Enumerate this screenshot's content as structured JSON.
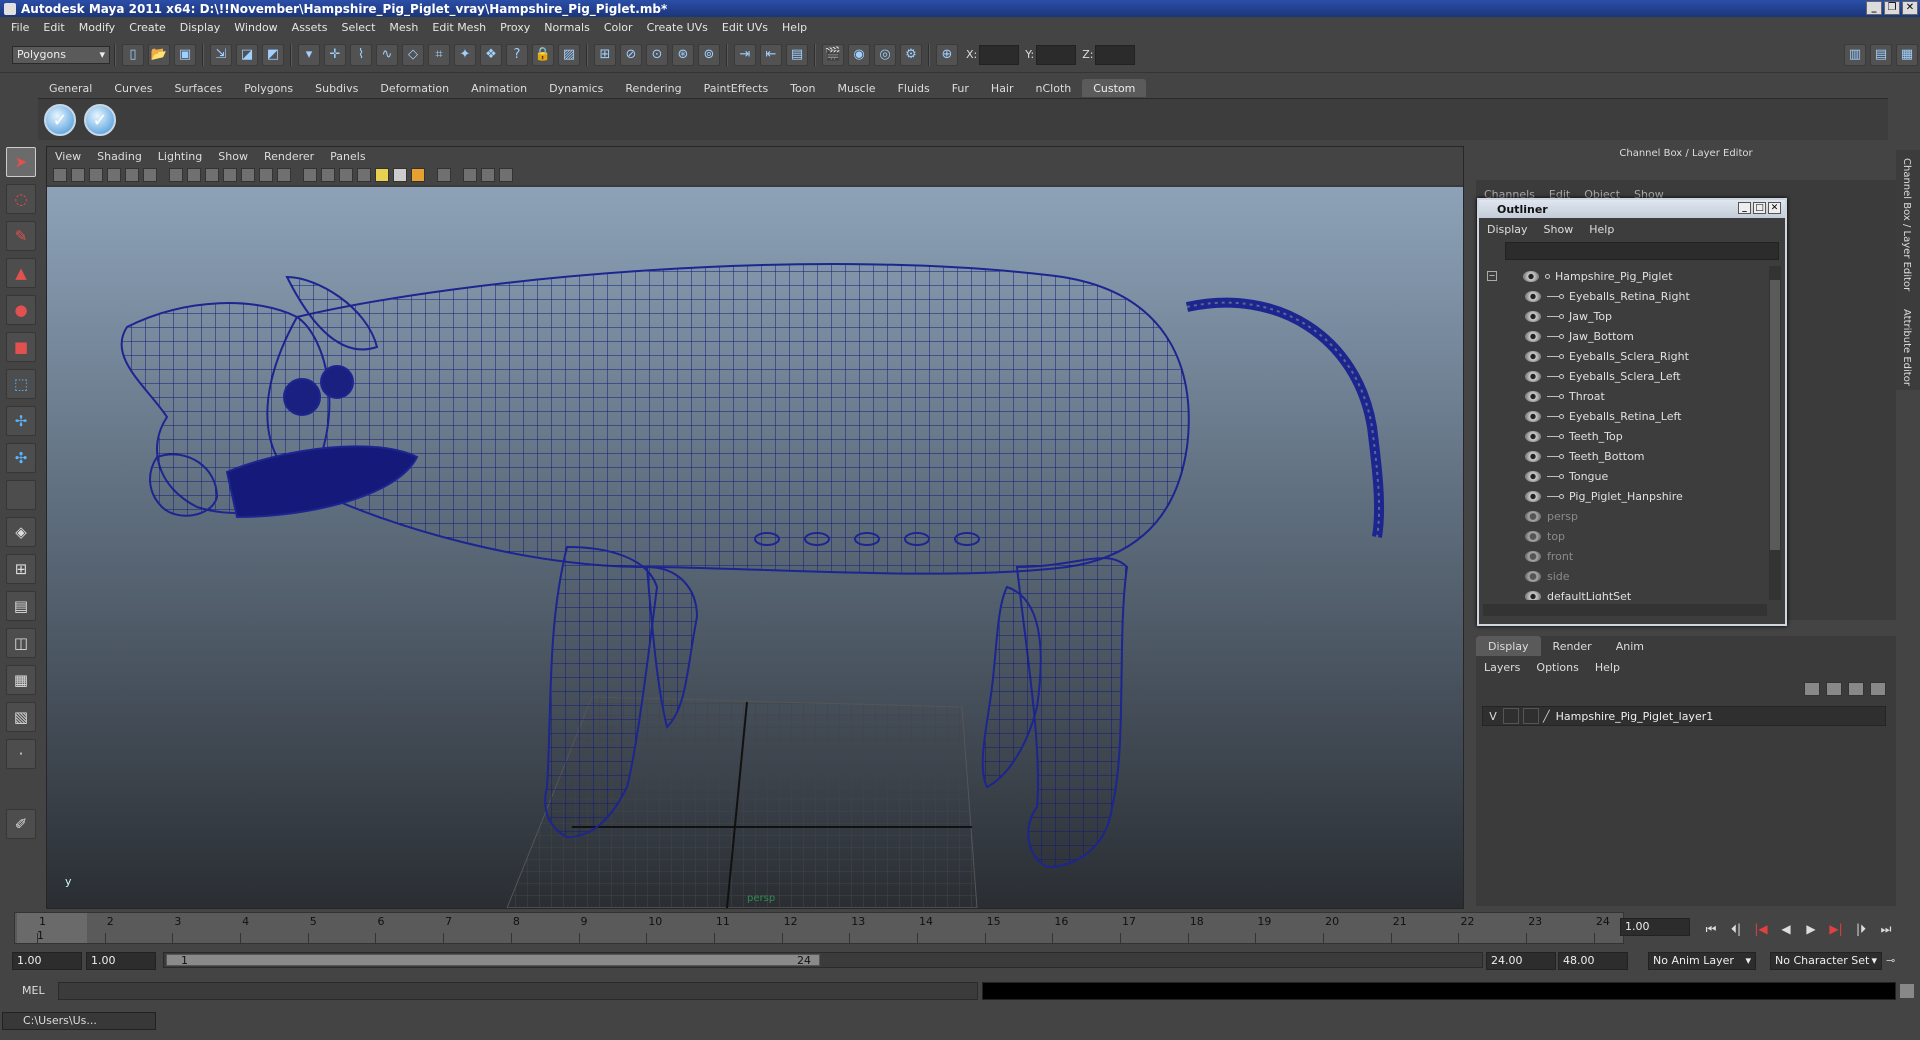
{
  "window": {
    "title": "Autodesk Maya 2011 x64: D:\\!!November\\Hampshire_Pig_Piglet_vray\\Hampshire_Pig_Piglet.mb*"
  },
  "menubar": [
    "File",
    "Edit",
    "Modify",
    "Create",
    "Display",
    "Window",
    "Assets",
    "Select",
    "Mesh",
    "Edit Mesh",
    "Proxy",
    "Normals",
    "Color",
    "Create UVs",
    "Edit UVs",
    "Help"
  ],
  "status": {
    "mode": "Polygons",
    "x_label": "X:",
    "y_label": "Y:",
    "z_label": "Z:"
  },
  "shelf": {
    "tabs": [
      "General",
      "Curves",
      "Surfaces",
      "Polygons",
      "Subdivs",
      "Deformation",
      "Animation",
      "Dynamics",
      "Rendering",
      "PaintEffects",
      "Toon",
      "Muscle",
      "Fluids",
      "Fur",
      "Hair",
      "nCloth",
      "Custom"
    ],
    "active_tab": "Custom"
  },
  "viewport": {
    "menu": [
      "View",
      "Shading",
      "Lighting",
      "Show",
      "Renderer",
      "Panels"
    ],
    "axis_label": "y",
    "camera": "persp"
  },
  "channel_box": {
    "header": "Channel Box / Layer Editor",
    "menu": [
      "Channels",
      "Edit",
      "Object",
      "Show"
    ]
  },
  "side_tabs": [
    "Channel Box / Layer Editor",
    "Attribute Editor"
  ],
  "outliner": {
    "title": "Outliner",
    "menu": [
      "Display",
      "Show",
      "Help"
    ],
    "root": "Hampshire_Pig_Piglet",
    "children": [
      "Eyeballs_Retina_Right",
      "Jaw_Top",
      "Jaw_Bottom",
      "Eyeballs_Sclera_Right",
      "Eyeballs_Sclera_Left",
      "Throat",
      "Eyeballs_Retina_Left",
      "Teeth_Top",
      "Teeth_Bottom",
      "Tongue",
      "Pig_Piglet_Hanpshire"
    ],
    "cameras": [
      "persp",
      "top",
      "front",
      "side"
    ],
    "last": "defaultLightSet"
  },
  "layer_editor": {
    "tabs": [
      "Display",
      "Render",
      "Anim"
    ],
    "active_tab": "Display",
    "menu": [
      "Layers",
      "Options",
      "Help"
    ],
    "layers": [
      {
        "visible": "V",
        "name": "Hampshire_Pig_Piglet_layer1"
      }
    ]
  },
  "time_slider": {
    "ticks": [
      "1",
      "2",
      "3",
      "4",
      "5",
      "6",
      "7",
      "8",
      "9",
      "10",
      "11",
      "12",
      "13",
      "14",
      "15",
      "16",
      "17",
      "18",
      "19",
      "20",
      "21",
      "22",
      "23",
      "24"
    ],
    "current_marker": "1",
    "current_frame": "1.00"
  },
  "range": {
    "start": "1.00",
    "inner_start": "1.00",
    "slider_start": "1",
    "slider_end": "24",
    "end": "24.00",
    "outer_end": "48.00",
    "anim_layer": "No Anim Layer",
    "char_set": "No Character Set"
  },
  "command_line": {
    "label": "MEL"
  },
  "taskbar": {
    "item": "C:\\Users\\Us..."
  }
}
